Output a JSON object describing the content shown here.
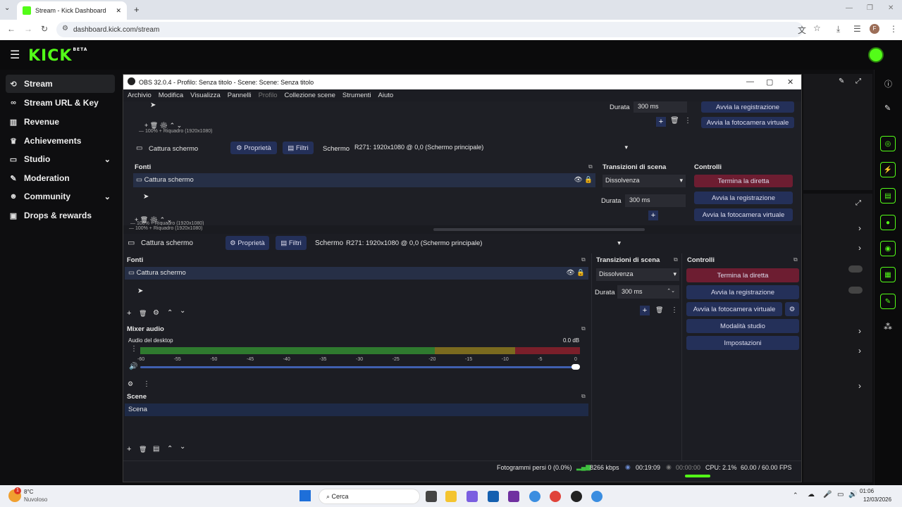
{
  "browser": {
    "tab_title": "Stream - Kick Dashboard",
    "url": "dashboard.kick.com/stream",
    "avatar_letter": "F"
  },
  "kick": {
    "logo": "KICK",
    "logo_badge": "BETA",
    "accent": "#53fc18",
    "sidebar": [
      {
        "label": "Stream",
        "icon": "link-icon",
        "active": true
      },
      {
        "label": "Stream URL & Key",
        "icon": "key-link-icon"
      },
      {
        "label": "Revenue",
        "icon": "chart-icon"
      },
      {
        "label": "Achievements",
        "icon": "trophy-icon"
      },
      {
        "label": "Studio",
        "icon": "monitor-icon",
        "chevron": true
      },
      {
        "label": "Moderation",
        "icon": "wrench-icon"
      },
      {
        "label": "Community",
        "icon": "people-icon",
        "chevron": true
      },
      {
        "label": "Drops & rewards",
        "icon": "gift-icon"
      }
    ]
  },
  "obs": {
    "title": "OBS 32.0.4 - Profilo: Senza titolo - Scene: Scene: Senza titolo",
    "menu": [
      "Archivio",
      "Modifica",
      "Visualizza",
      "Pannelli",
      "Profilo",
      "Collezione scene",
      "Strumenti",
      "Aiuto"
    ],
    "zoom": "100%",
    "frame_label": "Riquadro (1920x1080)",
    "source_name": "Cattura schermo",
    "properties": "Proprietà",
    "filters": "Filtri",
    "screen_label": "Schermo",
    "screen_value": "R271: 1920x1080 @ 0,0 (Schermo principale)",
    "fonti_title": "Fonti",
    "fonti_item": "Cattura schermo",
    "transitions_title": "Transizioni di scena",
    "transition": "Dissolvenza",
    "duration_label": "Durata",
    "duration_value": "300 ms",
    "controls_title": "Controlli",
    "controls": {
      "stop": "Termina la diretta",
      "record": "Avvia la registrazione",
      "vcam": "Avvia la fotocamera virtuale",
      "studio": "Modalità studio",
      "settings": "Impostazioni"
    },
    "mixer_title": "Mixer audio",
    "mixer_channel": "Audio del desktop",
    "mixer_db": "0.0 dB",
    "mixer_ticks": [
      "-60",
      "-55",
      "-50",
      "-45",
      "-40",
      "-35",
      "-30",
      "-25",
      "-20",
      "-15",
      "-10",
      "-5",
      "0"
    ],
    "scenes_title": "Scene",
    "scene_item": "Scena",
    "status": {
      "dropped": "Fotogrammi persi 0 (0.0%)",
      "bitrate": "8266 kbps",
      "live_time": "00:19:09",
      "rec_time": "00:00:00",
      "cpu": "CPU: 2.1%",
      "fps": "60.00 / 60.00 FPS"
    }
  },
  "taskbar": {
    "temp": "8°C",
    "weather": "Nuvoloso",
    "search": "Cerca",
    "time": "01:06",
    "date": "12/03/2026",
    "notif_count": "1"
  }
}
